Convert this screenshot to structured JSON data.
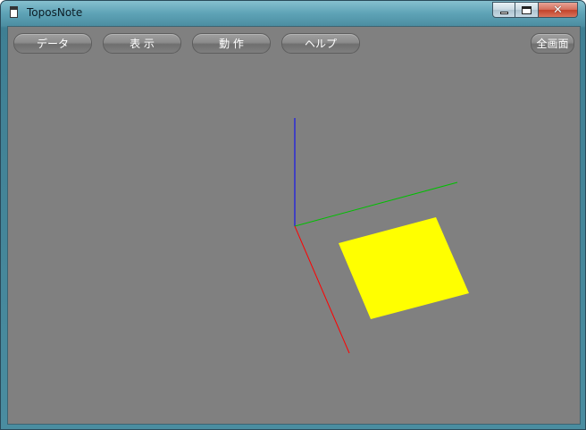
{
  "window": {
    "title": "ToposNote",
    "app_icon": "notepad-icon"
  },
  "toolbar": {
    "data_label": "データ",
    "view_label": "表 示",
    "action_label": "動 作",
    "help_label": "ヘルプ",
    "fullscreen_label": "全画面"
  },
  "scene": {
    "background": "#808080",
    "axes": [
      {
        "name": "x",
        "color": "#ff0000"
      },
      {
        "name": "y",
        "color": "#00c000"
      },
      {
        "name": "z",
        "color": "#0000ff"
      }
    ],
    "plane_color": "#ffff00"
  }
}
